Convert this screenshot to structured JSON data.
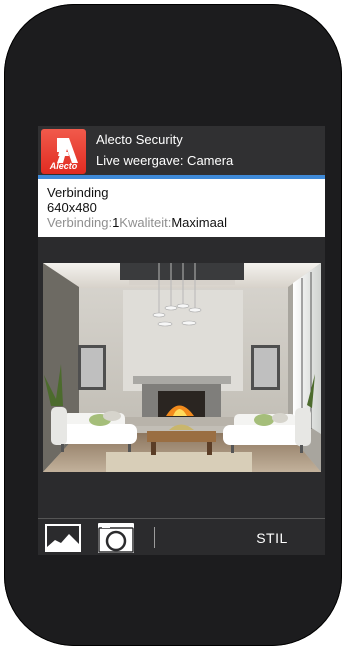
{
  "header": {
    "logo_text": "Alecto",
    "app_name": "Alecto Security",
    "screen_title": "Live weergave: Camera"
  },
  "info": {
    "connection_label": "Verbinding",
    "resolution": "640x480",
    "connection_prefix": "Verbinding:",
    "connection_value": "1",
    "quality_prefix": "Kwaliteit:",
    "quality_value": "Maximaal"
  },
  "bottom_bar": {
    "gallery_icon": "image-gallery-icon",
    "camera_icon": "camera-icon",
    "silent_label": "STIL"
  },
  "colors": {
    "phone_body": "#1c1c1e",
    "screen_background": "#2b2b2d",
    "header_background": "#303032",
    "accent_blue": "#3f8ad8",
    "logo_red": "#e12b21",
    "muted_text": "#8f8f8f"
  }
}
